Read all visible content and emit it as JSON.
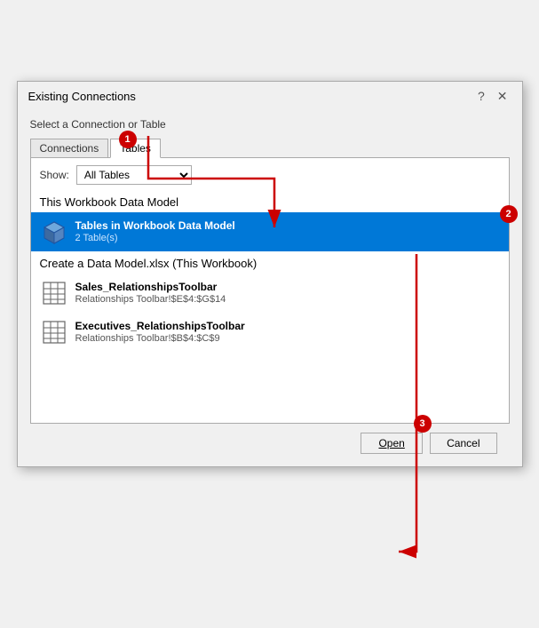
{
  "title": "Existing Connections",
  "titlebar": {
    "help_icon": "?",
    "close_icon": "✕"
  },
  "section_label": "Select a Connection or Table",
  "tabs": {
    "connections_label": "Connections",
    "tables_label": "Tables",
    "active": "Tables"
  },
  "show": {
    "label": "Show:",
    "value": "All Tables"
  },
  "groups": [
    {
      "name": "This Workbook Data Model",
      "items": [
        {
          "title": "Tables in Workbook Data Model",
          "subtitle": "2 Table(s)",
          "selected": true,
          "icon_type": "cube"
        }
      ]
    },
    {
      "name": "Create a Data Model.xlsx (This Workbook)",
      "items": [
        {
          "title": "Sales_RelationshipsToolbar",
          "subtitle": "Relationships Toolbar!$E$4:$G$14",
          "selected": false,
          "icon_type": "table"
        },
        {
          "title": "Executives_RelationshipsToolbar",
          "subtitle": "Relationships Toolbar!$B$4:$C$9",
          "selected": false,
          "icon_type": "table"
        }
      ]
    }
  ],
  "buttons": {
    "open_label": "Open",
    "cancel_label": "Cancel"
  },
  "annotations": {
    "1": "1",
    "2": "2",
    "3": "3"
  }
}
